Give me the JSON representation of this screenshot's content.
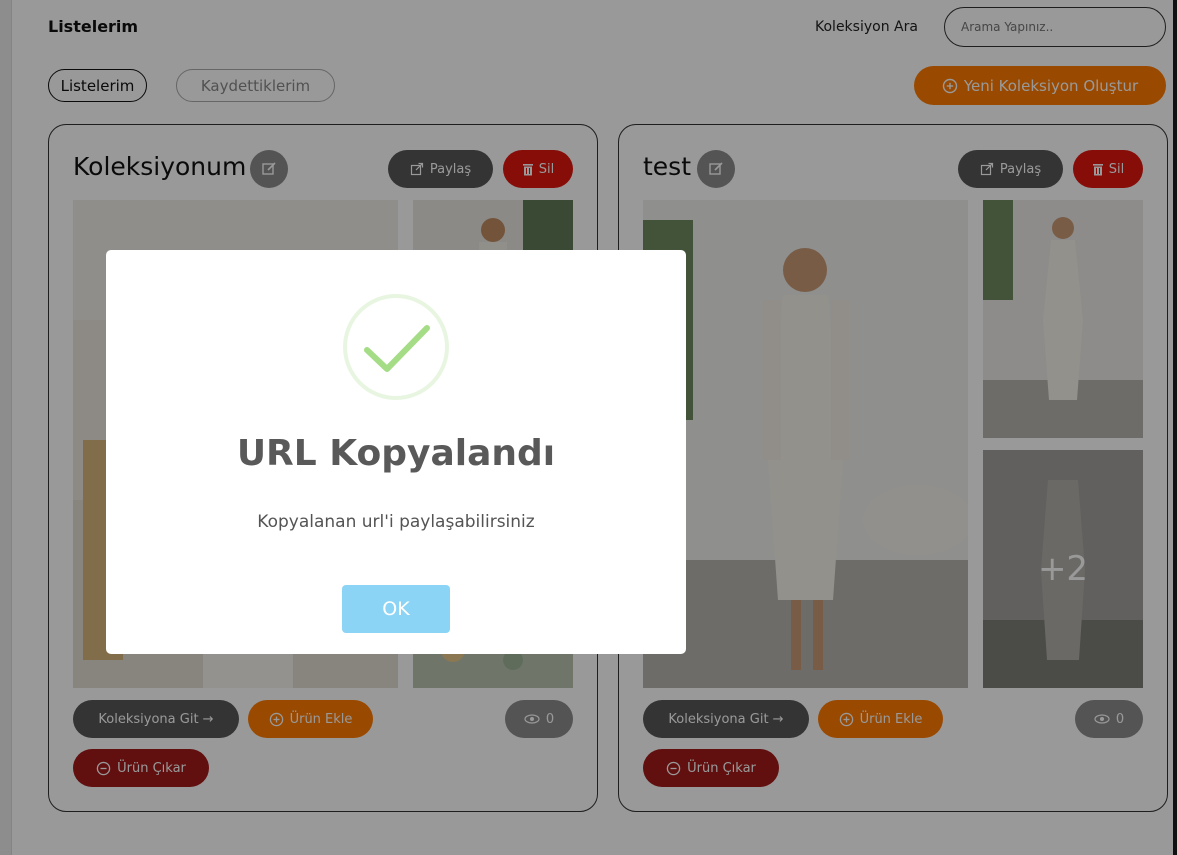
{
  "header": {
    "title": "Listelerim",
    "search_label": "Koleksiyon Ara",
    "search_placeholder": "Arama Yapınız.."
  },
  "tabs": [
    {
      "label": "Listelerim",
      "active": true
    },
    {
      "label": "Kaydettiklerim",
      "active": false
    }
  ],
  "new_collection_label": "Yeni Koleksiyon Oluştur",
  "collections": [
    {
      "title": "Koleksiyonum",
      "share_label": "Paylaş",
      "delete_label": "Sil",
      "goto_label": "Koleksiyona Git →",
      "add_label": "Ürün Ekle",
      "remove_label": "Ürün Çıkar",
      "views": "0"
    },
    {
      "title": "test",
      "share_label": "Paylaş",
      "delete_label": "Sil",
      "goto_label": "Koleksiyona Git →",
      "add_label": "Ürün Ekle",
      "remove_label": "Ürün Çıkar",
      "views": "0",
      "more_count": "+2"
    }
  ],
  "modal": {
    "title": "URL Kopyalandı",
    "text": "Kopyalanan url'i paylaşabilirsiniz",
    "ok_label": "OK"
  },
  "colors": {
    "accent_orange": "#ff7a00",
    "delete_red": "#e2170f",
    "remove_darkred": "#a31a1a",
    "ok_blue": "#8cd4f5",
    "success_green": "#a5dc86"
  },
  "icons": {
    "edit": "edit-icon",
    "share": "share-icon",
    "delete": "trash-icon",
    "add": "plus-circle-icon",
    "remove": "minus-circle-icon",
    "views": "eye-icon",
    "new": "plus-circle-icon",
    "success": "check-icon"
  }
}
